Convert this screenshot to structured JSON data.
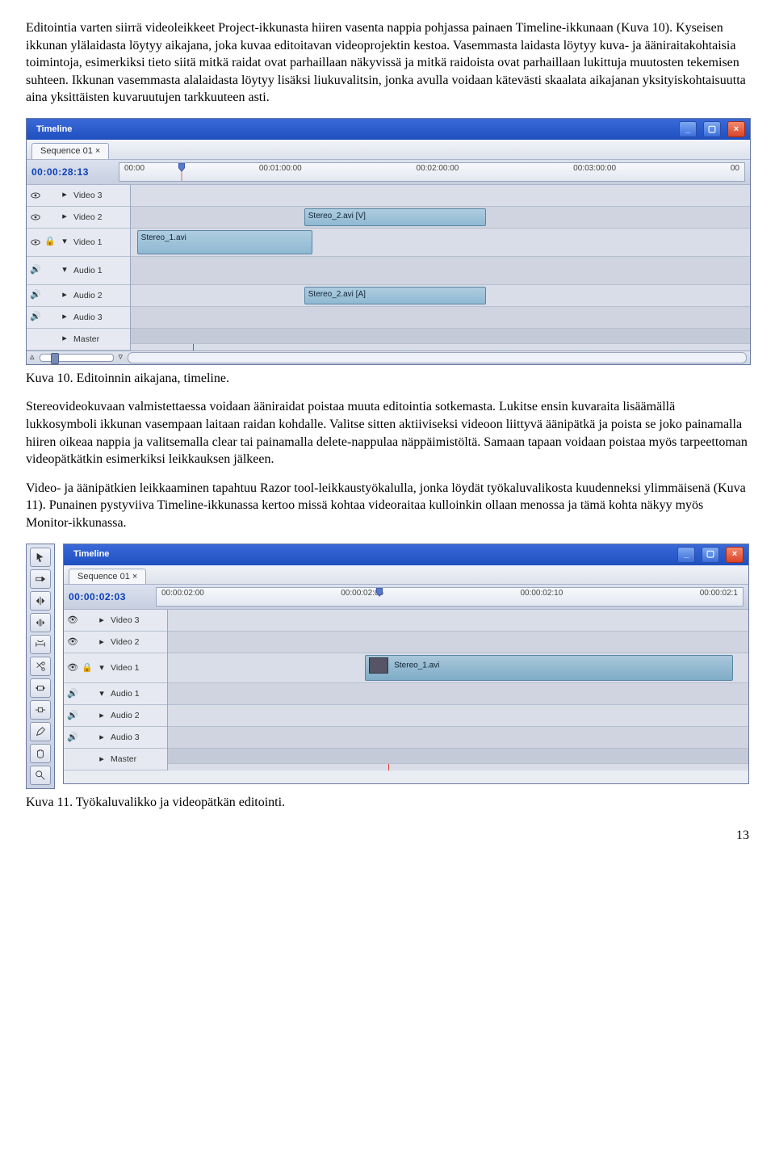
{
  "para1": "Editointia varten siirrä videoleikkeet Project-ikkunasta hiiren vasenta nappia pohjassa painaen Timeline-ikkunaan (Kuva 10). Kyseisen ikkunan ylälaidasta löytyy aikajana, joka kuvaa editoitavan videoprojektin kestoa. Vasemmasta laidasta löytyy kuva- ja ääniraitakohtaisia toimintoja, esimerkiksi tieto siitä mitkä raidat ovat parhaillaan näkyvissä ja mitkä raidoista ovat parhaillaan lukittuja muutosten tekemisen suhteen. Ikkunan vasemmasta alalaidasta löytyy lisäksi liukuvalitsin, jonka avulla voidaan kätevästi skaalata aikajanan yksityiskohtaisuutta aina yksittäisten kuvaruutujen tarkkuuteen asti.",
  "caption1": "Kuva 10. Editoinnin aikajana, timeline.",
  "para2": "Stereovideokuvaan valmistettaessa voidaan ääniraidat poistaa muuta editointia sotkemasta. Lukitse ensin kuvaraita lisäämällä lukkosymboli ikkunan vasempaan laitaan raidan kohdalle. Valitse sitten aktiiviseksi videoon liittyvä äänipätkä ja poista se joko painamalla hiiren oikeaa nappia ja valitsemalla clear tai painamalla delete-nappulaa näppäimistöltä. Samaan tapaan voidaan poistaa myös tarpeettoman videopätkätkin esimerkiksi leikkauksen jälkeen.",
  "para3": "Video- ja äänipätkien leikkaaminen tapahtuu Razor tool-leikkaustyökalulla, jonka löydät työkaluvalikosta kuudenneksi ylimmäisenä (Kuva 11). Punainen pystyviiva Timeline-ikkunassa kertoo missä kohtaa videoraitaa kulloinkin ollaan menossa ja tämä kohta näkyy myös Monitor-ikkunassa.",
  "caption2": "Kuva 11. Työkaluvalikko ja videopätkän editointi.",
  "pagenum": "13",
  "timeline10": {
    "title": "Timeline",
    "sequence": "Sequence 01",
    "timecode": "00:00:28:13",
    "ruler": [
      "00:00",
      "00:01:00:00",
      "00:02:00:00",
      "00:03:00:00",
      "00"
    ],
    "tracks": [
      "Video 3",
      "Video 2",
      "Video 1",
      "Audio 1",
      "Audio 2",
      "Audio 3",
      "Master"
    ],
    "clips": {
      "video1": "Stereo_1.avi",
      "video2": "Stereo_2.avi [V]",
      "audio1": "Stereo_2.avi [A]"
    }
  },
  "timeline11": {
    "title": "Timeline",
    "sequence": "Sequence 01",
    "timecode": "00:00:02:03",
    "ruler": [
      "00:00:02:00",
      "00:00:02:05",
      "00:00:02:10",
      "00:00:02:1"
    ],
    "tracks": [
      "Video 3",
      "Video 2",
      "Video 1",
      "Audio 1",
      "Audio 2",
      "Audio 3",
      "Master"
    ],
    "clip": "Stereo_1.avi"
  },
  "winbtns": {
    "min": "_",
    "max": "▢",
    "close": "×"
  }
}
